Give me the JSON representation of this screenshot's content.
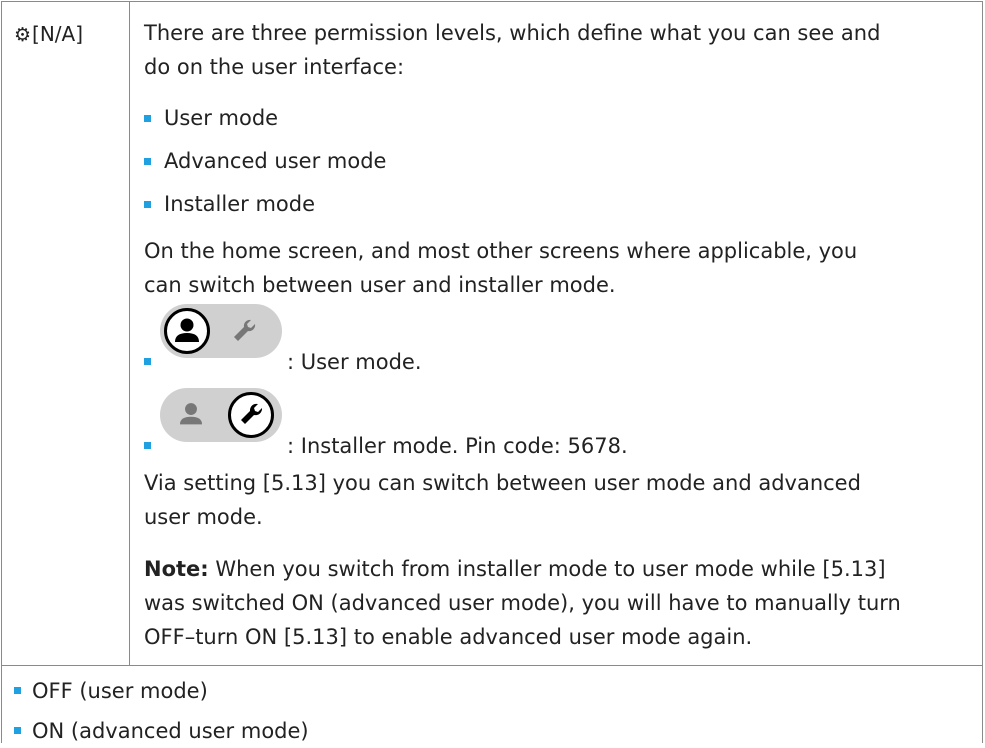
{
  "setting": {
    "id": "[N/A]",
    "icon": "gear-icon"
  },
  "description": {
    "intro": [
      "There are three permission levels, which define what you can see and",
      "do on the user interface:"
    ],
    "levels": [
      "User mode",
      "Advanced user mode",
      "Installer mode"
    ],
    "home_screen": [
      "On the home screen, and most other screens where applicable, you",
      "can switch between user and installer mode."
    ],
    "toggles": [
      {
        "icon": "user-mode-toggle-icon",
        "caption": ": User mode."
      },
      {
        "icon": "installer-mode-toggle-icon",
        "caption": ": Installer mode. Pin code: 5678."
      }
    ],
    "via_setting": [
      "Via setting [5.13] you can switch between user mode and advanced",
      "user mode."
    ],
    "note": {
      "label": "Note:",
      "lines": [
        " When you switch from installer mode to user mode while [5.13]",
        "was switched ON (advanced user mode), you will have to manually turn",
        "OFF–turn ON [5.13] to enable advanced user mode again."
      ]
    }
  },
  "values": [
    "OFF (user mode)",
    "ON (advanced user mode)"
  ],
  "colors": {
    "bullet": "#1fa0e0",
    "border": "#8a8a8a",
    "toggle_bg": "#d0d0d0"
  }
}
